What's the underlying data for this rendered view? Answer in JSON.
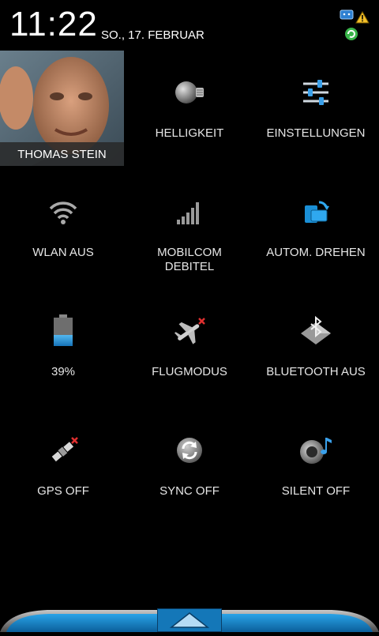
{
  "status": {
    "time": "11:22",
    "date": "SO., 17. FEBRUAR",
    "icons": [
      "message-icon",
      "warning-icon",
      "sync-status-icon"
    ]
  },
  "profile": {
    "name": "THOMAS STEIN"
  },
  "tiles": [
    {
      "label": "HELLIGKEIT",
      "icon": "brightness-bulb-icon"
    },
    {
      "label": "EINSTELLUNGEN",
      "icon": "settings-sliders-icon"
    },
    {
      "label": "WLAN AUS",
      "icon": "wifi-icon"
    },
    {
      "label": "MOBILCOM\nDEBITEL",
      "icon": "signal-bars-icon"
    },
    {
      "label": "AUTOM. DREHEN",
      "icon": "auto-rotate-icon"
    },
    {
      "label": "39%",
      "icon": "battery-icon",
      "battery_level": 0.39
    },
    {
      "label": "FLUGMODUS",
      "icon": "airplane-icon"
    },
    {
      "label": "BLUETOOTH AUS",
      "icon": "bluetooth-icon"
    },
    {
      "label": "GPS OFF",
      "icon": "gps-satellite-icon"
    },
    {
      "label": "SYNC OFF",
      "icon": "sync-icon"
    },
    {
      "label": "SILENT OFF",
      "icon": "speaker-icon"
    }
  ],
  "colors": {
    "accent": "#1a8fd6",
    "background": "#000000",
    "text": "#e8e8e8"
  }
}
